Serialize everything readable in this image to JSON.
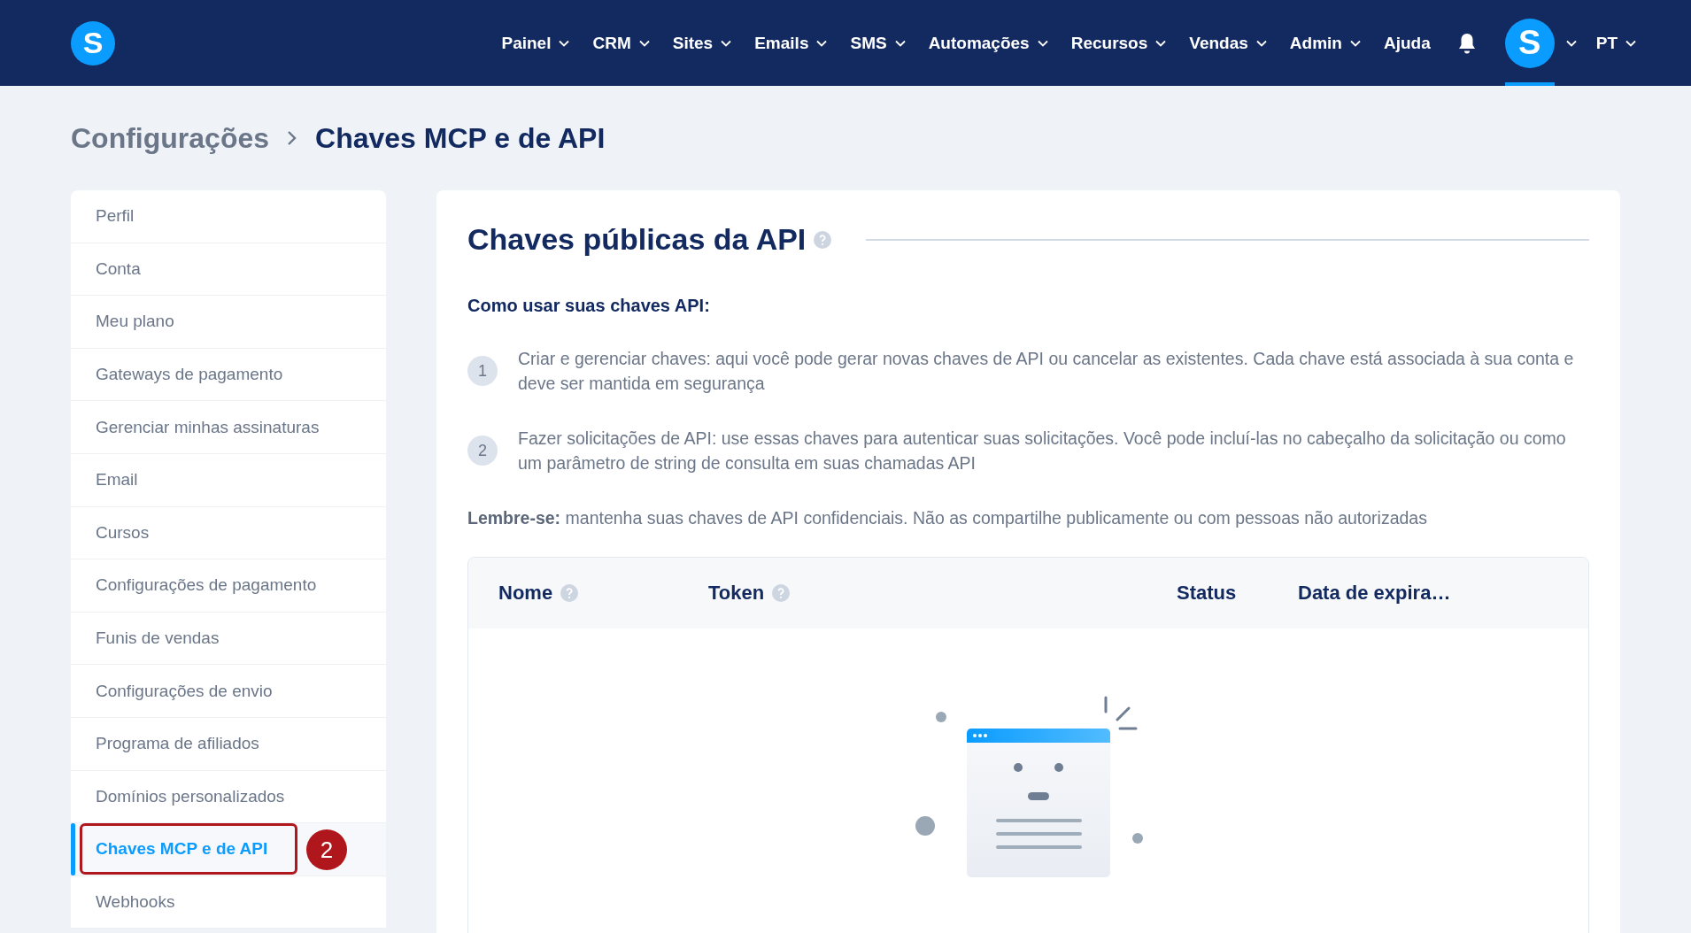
{
  "nav": {
    "logo": "S",
    "items": [
      {
        "label": "Painel",
        "dropdown": true
      },
      {
        "label": "CRM",
        "dropdown": true
      },
      {
        "label": "Sites",
        "dropdown": true
      },
      {
        "label": "Emails",
        "dropdown": true
      },
      {
        "label": "SMS",
        "dropdown": true
      },
      {
        "label": "Automações",
        "dropdown": true
      },
      {
        "label": "Recursos",
        "dropdown": true
      },
      {
        "label": "Vendas",
        "dropdown": true
      },
      {
        "label": "Admin",
        "dropdown": true
      },
      {
        "label": "Ajuda",
        "dropdown": false
      }
    ],
    "avatar": {
      "letter": "S",
      "selected": true
    },
    "language": "PT"
  },
  "breadcrumb": [
    "Configurações",
    "Chaves MCP e de API"
  ],
  "sidebar": {
    "items": [
      {
        "label": "Perfil",
        "selected": false
      },
      {
        "label": "Conta",
        "selected": false
      },
      {
        "label": "Meu plano",
        "selected": false
      },
      {
        "label": "Gateways de pagamento",
        "selected": false
      },
      {
        "label": "Gerenciar minhas assinaturas",
        "selected": false
      },
      {
        "label": "Email",
        "selected": false
      },
      {
        "label": "Cursos",
        "selected": false
      },
      {
        "label": "Configurações de pagamento",
        "selected": false
      },
      {
        "label": "Funis de vendas",
        "selected": false
      },
      {
        "label": "Configurações de envio",
        "selected": false
      },
      {
        "label": "Programa de afiliados",
        "selected": false
      },
      {
        "label": "Domínios personalizados",
        "selected": false
      },
      {
        "label": "Chaves MCP e de API",
        "selected": true,
        "annotation": "2"
      },
      {
        "label": "Webhooks",
        "selected": false
      }
    ]
  },
  "panel": {
    "title": "Chaves públicas da API",
    "subtitle": "Como usar suas chaves API:",
    "steps": [
      {
        "number": "1",
        "text": "Criar e gerenciar chaves: aqui você pode gerar novas chaves de API ou cancelar as existentes. Cada chave está associada à sua conta e deve ser mantida em segurança"
      },
      {
        "number": "2",
        "text": "Fazer solicitações de API: use essas chaves para autenticar suas solicitações. Você pode incluí-las no cabeçalho da solicitação ou como um parâmetro de string de consulta em suas chamadas API"
      }
    ],
    "reminder": "**Lembre-se:** mantenha suas chaves de API confidenciais. Não as compartilhe publicamente ou com pessoas não autorizadas",
    "table": {
      "columns": [
        {
          "label": "Nome",
          "help": true
        },
        {
          "label": "Token",
          "help": true
        },
        {
          "label": "Status",
          "help": false
        },
        {
          "label": "Data de expira…",
          "help": false
        }
      ]
    }
  }
}
